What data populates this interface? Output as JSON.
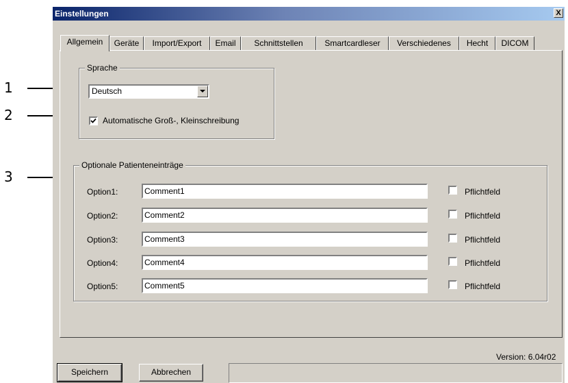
{
  "window": {
    "title": "Einstellungen",
    "close_label": "X"
  },
  "callouts": [
    "1",
    "2",
    "3"
  ],
  "tabs": [
    "Allgemein",
    "Geräte",
    "Import/Export",
    "Email",
    "Schnittstellen",
    "Smartcardleser",
    "Verschiedenes",
    "Hecht",
    "DICOM"
  ],
  "active_tab": "Allgemein",
  "language_group": {
    "legend": "Sprache",
    "selected_language": "Deutsch",
    "auto_case_label": "Automatische Groß-, Kleinschreibung",
    "auto_case_checked": true
  },
  "optional_group": {
    "legend": "Optionale Patienteneinträge",
    "options": [
      {
        "label": "Option1:",
        "value": "Comment1",
        "required_label": "Pflichtfeld",
        "required": false
      },
      {
        "label": "Option2:",
        "value": "Comment2",
        "required_label": "Pflichtfeld",
        "required": false
      },
      {
        "label": "Option3:",
        "value": "Comment3",
        "required_label": "Pflichtfeld",
        "required": false
      },
      {
        "label": "Option4:",
        "value": "Comment4",
        "required_label": "Pflichtfeld",
        "required": false
      },
      {
        "label": "Option5:",
        "value": "Comment5",
        "required_label": "Pflichtfeld",
        "required": false
      }
    ]
  },
  "footer": {
    "version": "Version: 6.04r02",
    "save_label": "Speichern",
    "cancel_label": "Abbrechen"
  }
}
